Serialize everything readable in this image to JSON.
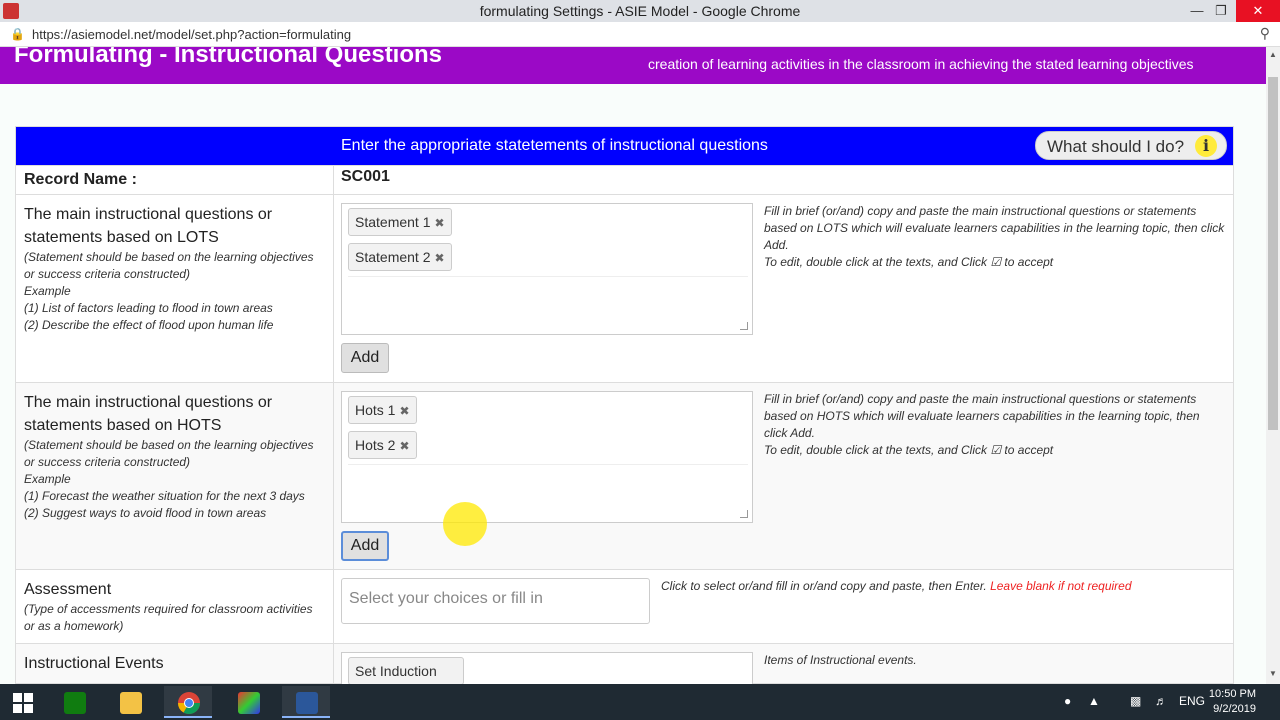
{
  "window": {
    "title": "formulating Settings - ASIE Model - Google Chrome",
    "minimize": "—",
    "restore": "❐",
    "close": "✕"
  },
  "address": {
    "url": "https://asiemodel.net/model/set.php?action=formulating",
    "lock_icon": "lock-icon",
    "zoom_icon": "zoom-icon"
  },
  "header": {
    "title": "Formulating - Instructional Questions",
    "description": "creation of learning activities in the classroom in achieving the stated learning objectives"
  },
  "panel": {
    "title": "Enter the appropriate statetements of instructional questions",
    "help_button": "What should I do?"
  },
  "record": {
    "label": "Record Name :",
    "value": "SC001"
  },
  "lots": {
    "label": "The main instructional questions or statements based on LOTS",
    "notes": [
      "(Statement should be based on the learning objectives or success criteria constructed)",
      "Example",
      "(1) List of factors leading to flood in town areas",
      "(2) Describe the effect of flood upon human life"
    ],
    "tags": [
      "Statement 1",
      "Statement 2"
    ],
    "add": "Add",
    "help": [
      "Fill in brief (or/and) copy and paste the main instructional questions or statements based on LOTS which will evaluate learners capabilities in the learning topic, then click Add.",
      "To edit, double click at the texts, and Click ☑ to accept"
    ]
  },
  "hots": {
    "label": "The main instructional questions or statements based on HOTS",
    "notes": [
      "(Statement should be based on the learning objectives or success criteria constructed)",
      "Example",
      "(1) Forecast the weather situation for the next 3 days",
      "(2) Suggest ways to avoid flood in town areas"
    ],
    "tags": [
      "Hots 1",
      "Hots 2"
    ],
    "add": "Add",
    "help": [
      "Fill in brief (or/and) copy and paste the main instructional questions or statements based on HOTS which will evaluate learners capabilities in the learning topic, then click Add.",
      "To edit, double click at the texts, and Click ☑ to accept"
    ]
  },
  "assessment": {
    "label": "Assessment",
    "note": "(Type of accessments required for classroom activities or as a homework)",
    "placeholder": "Select your choices or fill in",
    "help": "Click to select or/and fill in or/and copy and paste, then Enter.",
    "help_red": "Leave blank if not required"
  },
  "events": {
    "label": "Instructional Events",
    "tag": "Set Induction",
    "help": "Items of Instructional events."
  },
  "tag_remove": "✖",
  "taskbar": {
    "lang": "ENG",
    "time": "10:50 PM",
    "date": "9/2/2019"
  },
  "colors": {
    "header": "#9b09c6",
    "panel_head": "#0000ff",
    "info": "#ffeb3b"
  }
}
